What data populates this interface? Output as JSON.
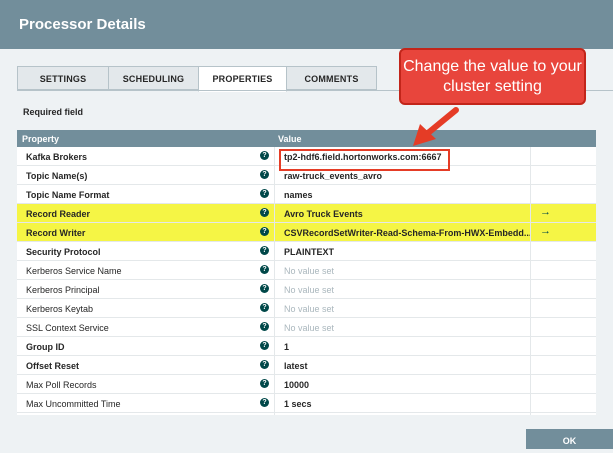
{
  "dialog": {
    "title": "Processor Details"
  },
  "tabs": [
    {
      "label": "SETTINGS"
    },
    {
      "label": "SCHEDULING"
    },
    {
      "label": "PROPERTIES"
    },
    {
      "label": "COMMENTS"
    }
  ],
  "required_label": "Required field",
  "grid": {
    "header_property": "Property",
    "header_value": "Value",
    "help_glyph": "?",
    "goto_glyph": "→",
    "rows": [
      {
        "name": "Kafka Brokers",
        "value": "tp2-hdf6.field.hortonworks.com:6667"
      },
      {
        "name": "Topic Name(s)",
        "value": "raw-truck_events_avro"
      },
      {
        "name": "Topic Name Format",
        "value": "names"
      },
      {
        "name": "Record Reader",
        "value": "Avro Truck Events"
      },
      {
        "name": "Record Writer",
        "value": "CSVRecordSetWriter-Read-Schema-From-HWX-Embedd..."
      },
      {
        "name": "Security Protocol",
        "value": "PLAINTEXT"
      },
      {
        "name": "Kerberos Service Name",
        "value": "No value set"
      },
      {
        "name": "Kerberos Principal",
        "value": "No value set"
      },
      {
        "name": "Kerberos Keytab",
        "value": "No value set"
      },
      {
        "name": "SSL Context Service",
        "value": "No value set"
      },
      {
        "name": "Group ID",
        "value": "1"
      },
      {
        "name": "Offset Reset",
        "value": "latest"
      },
      {
        "name": "Max Poll Records",
        "value": "10000"
      },
      {
        "name": "Max Uncommitted Time",
        "value": "1 secs"
      }
    ]
  },
  "annotation": {
    "text": "Change the value to your cluster setting"
  },
  "buttons": {
    "ok": "OK"
  },
  "colors": {
    "header": "#728e9b",
    "highlight": "#f5f545",
    "callout": "#e8453c",
    "help_icon": "#004849"
  }
}
